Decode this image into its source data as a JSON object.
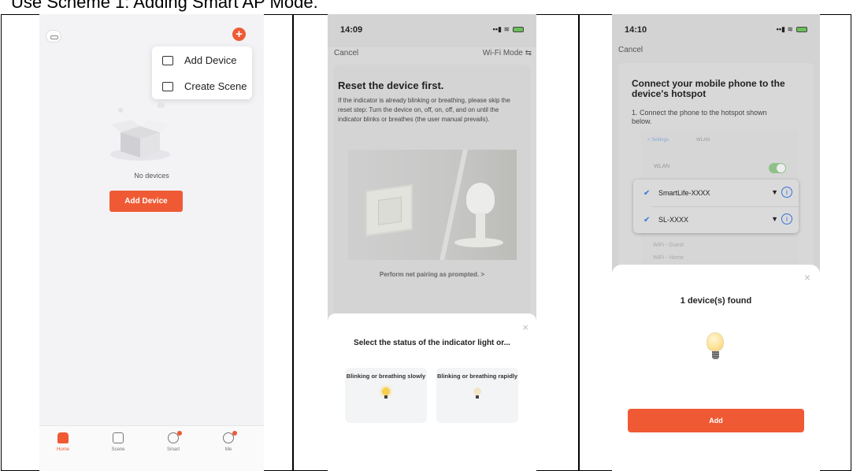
{
  "caption": "Use Scheme 1: Adding Smart AP Mode.",
  "accent_color": "#ef5a35",
  "panel1": {
    "menu": {
      "add_device": "Add Device",
      "create_scene": "Create Scene"
    },
    "empty_text": "No devices",
    "add_button": "Add Device",
    "tabs": [
      {
        "label": "Home",
        "icon": "home-icon",
        "active": true
      },
      {
        "label": "Scene",
        "icon": "scene-icon"
      },
      {
        "label": "Smart",
        "icon": "smart-icon"
      },
      {
        "label": "Me",
        "icon": "me-icon"
      }
    ]
  },
  "panel2": {
    "time": "14:09",
    "signal": "▪▪▮ ≋",
    "cancel": "Cancel",
    "wifi_mode": "Wi-Fi Mode ⇆",
    "title": "Reset the device first.",
    "instructions": "If the indicator is already blinking or breathing, please skip the reset step: Turn the device on, off, on, off, and on until the indicator blinks or breathes (the user manual prevails).",
    "perform": "Perform net pairing as prompted. >",
    "sheet_title": "Select the status of the indicator light or...",
    "sheet_close": "×",
    "options": [
      {
        "label": "Blinking or breathing slowly",
        "bulb_color": "#f6cf4c"
      },
      {
        "label": "Blinking or breathing rapidly",
        "bulb_color": "#f3e6c7"
      }
    ]
  },
  "panel3": {
    "time": "14:10",
    "signal": "▪▪▮ ≋",
    "cancel": "Cancel",
    "title": "Connect your mobile phone to the device's hotspot",
    "step": "1. Connect the phone to the hotspot shown below.",
    "settings_back": "< Settings",
    "settings_title": "WLAN",
    "wlan_label": "WLAN",
    "networks": [
      {
        "name": "SmartLife-XXXX"
      },
      {
        "name": "SL-XXXX"
      }
    ],
    "other_networks": [
      "WiFi - Guest",
      "WiFi - Home"
    ],
    "sheet_close": "×",
    "found": "1 device(s) found",
    "add_button": "Add"
  }
}
